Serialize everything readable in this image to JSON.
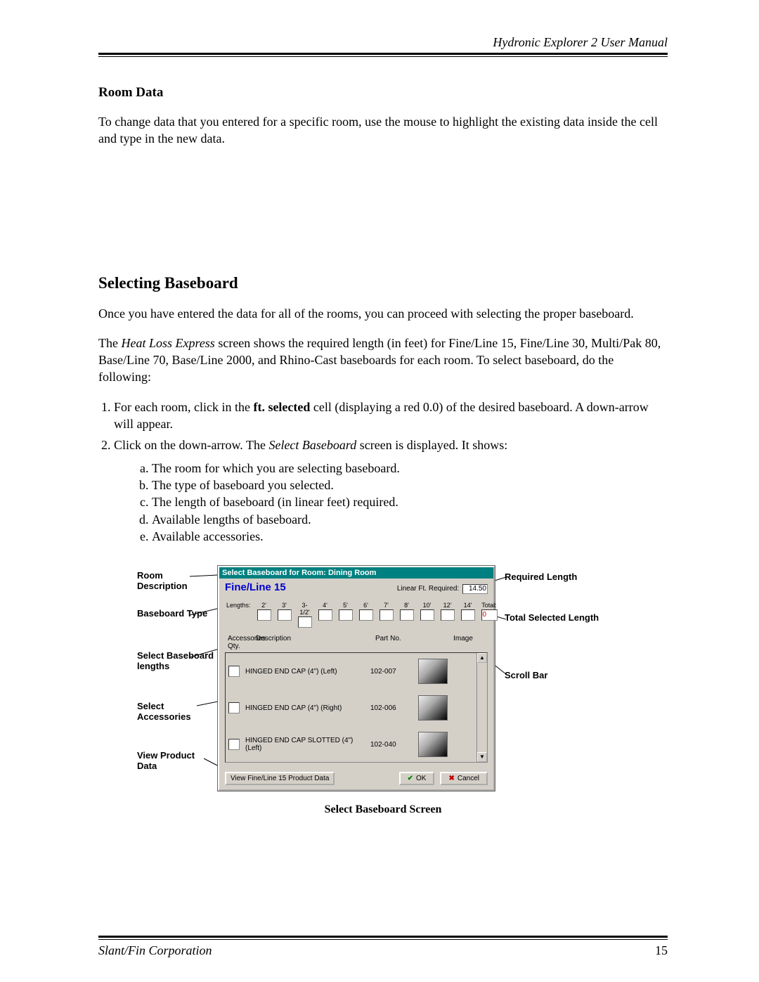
{
  "header": {
    "title": "Hydronic Explorer 2 User Manual"
  },
  "section1": {
    "heading": "Room Data",
    "p": "To change data that you entered for a specific room, use the mouse to highlight the existing data inside the cell and type in the new data."
  },
  "section2": {
    "heading": "Selecting Baseboard",
    "p1": "Once you have entered the data for all of the rooms, you can proceed with selecting the proper baseboard.",
    "p2a": "The ",
    "p2b": "Heat Loss Express",
    "p2c": " screen shows the required length (in feet) for Fine/Line 15, Fine/Line 30, Multi/Pak 80, Base/Line 70, Base/Line 2000, and Rhino-Cast baseboards for each room. To select baseboard, do the following:",
    "li1a": "For each room, click in the ",
    "li1b": "ft. selected",
    "li1c": " cell (displaying a red 0.0) of the desired baseboard. A down-arrow will appear.",
    "li2a": "Click on the down-arrow. The ",
    "li2b": "Select Baseboard",
    "li2c": " screen is displayed. It shows:",
    "subitems": [
      "The room for which you are selecting baseboard.",
      "The type of baseboard you selected.",
      "The length of baseboard (in linear feet) required.",
      "Available lengths of baseboard.",
      "Available accessories."
    ]
  },
  "callouts": {
    "room": "Room Description",
    "type": "Baseboard Type",
    "selLen": "Select Baseboard lengths",
    "selAcc": "Select Accessories",
    "viewData": "View Product Data",
    "reqLen": "Required Length",
    "totLen": "Total Selected Length",
    "scroll": "Scroll Bar"
  },
  "dialog": {
    "title": "Select Baseboard for Room: Dining Room",
    "baseboard_type": "Fine/Line 15",
    "req_label": "Linear Ft. Required:",
    "req_value": "14.50",
    "lengths_label": "Lengths:",
    "lengths": [
      "2'",
      "3'",
      "3-1/2'",
      "4'",
      "5'",
      "6'",
      "7'",
      "8'",
      "10'",
      "12'",
      "14'"
    ],
    "total_label": "Total:",
    "total_value": "0",
    "acc_head": {
      "c1": "Accessories Qty.",
      "c2": "Description",
      "c3": "Part No.",
      "c4": "Image"
    },
    "acc_items": [
      {
        "desc": "HINGED END CAP (4\") (Left)",
        "part": "102-007"
      },
      {
        "desc": "HINGED END CAP (4\") (Right)",
        "part": "102-006"
      },
      {
        "desc": "HINGED END CAP SLOTTED (4\") (Left)",
        "part": "102-040"
      }
    ],
    "view_product": "View Fine/Line 15 Product Data",
    "ok": "OK",
    "cancel": "Cancel"
  },
  "caption": "Select Baseboard Screen",
  "footer": {
    "corp": "Slant/Fin Corporation",
    "page": "15"
  }
}
